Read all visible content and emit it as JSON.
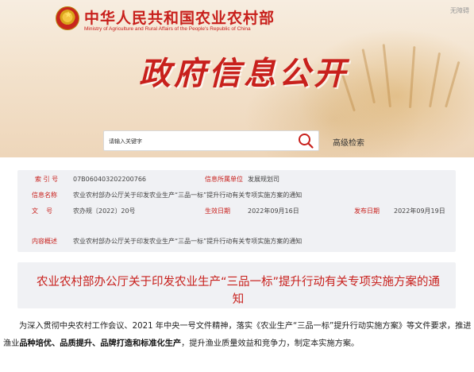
{
  "header": {
    "ministry_cn": "中华人民共和国农业农村部",
    "ministry_en": "Ministry of Agriculture and Rural Affairs of the People's Republic of China",
    "watermark": "无障碍",
    "section_title": "政府信息公开"
  },
  "search": {
    "value": "请输入关键字",
    "advanced_label": "高级检索"
  },
  "info": {
    "index_label": "索 引 号",
    "index_value": "07B060403202200766",
    "source_label": "信息所属单位",
    "source_value": "发展规划司",
    "name_label": "信息名称",
    "name_value": "农业农村部办公厅关于印发农业生产“三品一标”提升行动有关专项实施方案的通知",
    "doc_label": "文    号",
    "doc_value": "农办规〔2022〕20号",
    "effective_label": "生效日期",
    "effective_value": "2022年09月16日",
    "publish_label": "发布日期",
    "publish_value": "2022年09月19日",
    "summary_label": "内容概述",
    "summary_value": "农业农村部办公厅关于印发农业生产“三品一标”提升行动有关专项实施方案的通知"
  },
  "notice": {
    "title": "农业农村部办公厅关于印发农业生产“三品一标”提升行动有关专项实施方案的通知"
  },
  "body": {
    "part1": "为深入贯彻中央农村工作会议、2021 年中央一号文件精神，落实《农业生产“三品一标”提升行动实施方案》等文件要求，推进渔业",
    "bold": "品种培优、品质提升、品牌打造和标准化生产",
    "part2": "，提升渔业质量效益和竞争力，制定本实施方案。"
  },
  "colors": {
    "accent_red": "#c8201c",
    "panel_gray": "#f0f1f4"
  }
}
